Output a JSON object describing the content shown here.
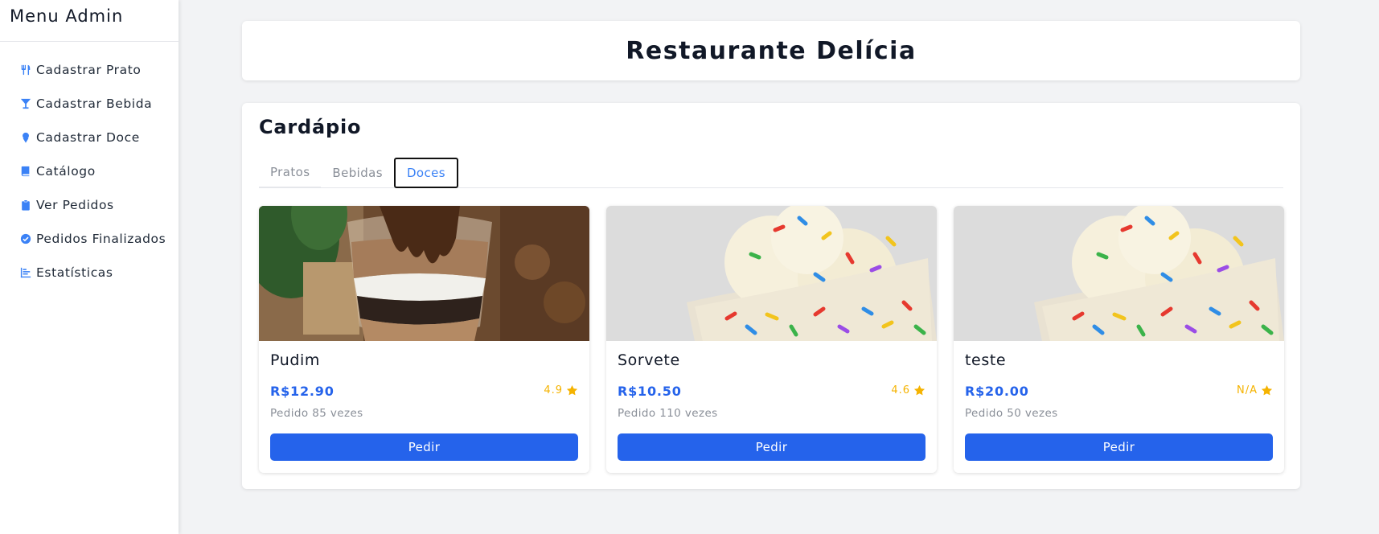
{
  "sidebar": {
    "title": "Menu Admin",
    "items": [
      {
        "label": "Cadastrar Prato",
        "icon": "utensils-icon"
      },
      {
        "label": "Cadastrar Bebida",
        "icon": "cocktail-icon"
      },
      {
        "label": "Cadastrar Doce",
        "icon": "ice-cream-icon"
      },
      {
        "label": "Catálogo",
        "icon": "book-icon"
      },
      {
        "label": "Ver Pedidos",
        "icon": "clipboard-icon"
      },
      {
        "label": "Pedidos Finalizados",
        "icon": "check-circle-icon"
      },
      {
        "label": "Estatísticas",
        "icon": "bar-chart-icon"
      }
    ]
  },
  "header": {
    "title": "Restaurante Delícia"
  },
  "menu": {
    "title": "Cardápio",
    "tabs": [
      {
        "label": "Pratos",
        "active": false
      },
      {
        "label": "Bebidas",
        "active": false
      },
      {
        "label": "Doces",
        "active": true
      }
    ],
    "items": [
      {
        "name": "Pudim",
        "price": "R$12.90",
        "rating": "4.9",
        "orders": "Pedido 85 vezes",
        "button": "Pedir",
        "image": "chocolate-parfait-photo"
      },
      {
        "name": "Sorvete",
        "price": "R$10.50",
        "rating": "4.6",
        "orders": "Pedido 110 vezes",
        "button": "Pedir",
        "image": "ice-cream-sprinkles-photo"
      },
      {
        "name": "teste",
        "price": "R$20.00",
        "rating": "N/A",
        "orders": "Pedido 50 vezes",
        "button": "Pedir",
        "image": "ice-cream-sprinkles-photo"
      }
    ]
  },
  "colors": {
    "accent": "#2563eb",
    "star": "#f5b301",
    "background": "#f2f3f5"
  }
}
